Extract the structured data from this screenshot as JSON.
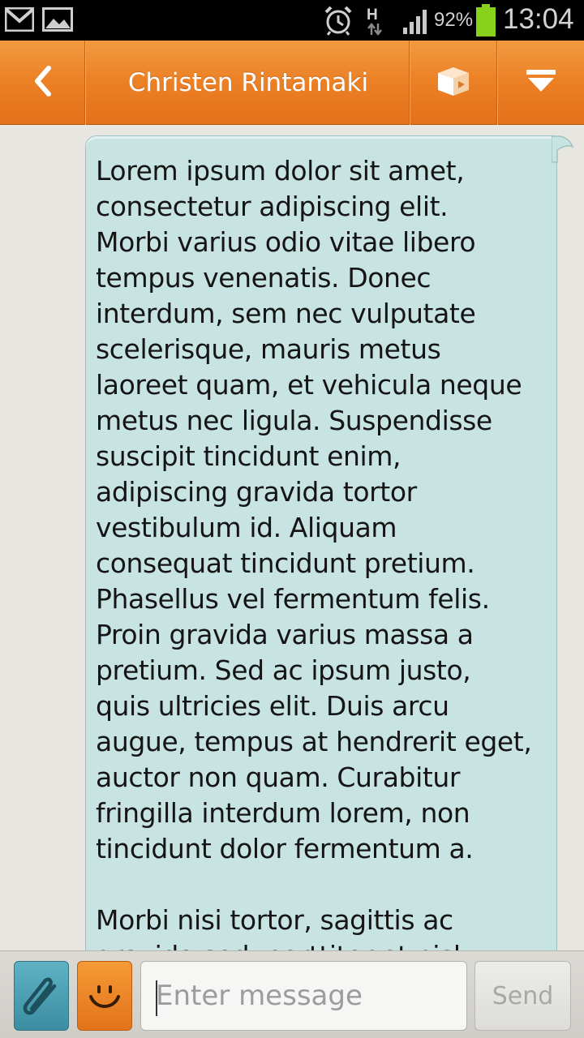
{
  "status_bar": {
    "network_type": "H",
    "battery_percent": "92%",
    "time": "13:04",
    "icons": [
      "gmail-icon",
      "gallery-icon",
      "alarm-clock-icon",
      "hspa-data-icon",
      "signal-strength-icon",
      "battery-icon"
    ]
  },
  "action_bar": {
    "contact_name": "Christen Rintamaki",
    "icons": [
      "back-arrow-icon",
      "box-icon",
      "overflow-menu-icon"
    ]
  },
  "conversation": {
    "messages": [
      {
        "direction": "outgoing",
        "text": "Lorem ipsum dolor sit amet,\nconsectetur adipiscing elit.\nMorbi varius odio vitae libero\ntempus venenatis. Donec\ninterdum, sem nec vulputate\nscelerisque, mauris metus\nlaoreet quam, et vehicula neque\nmetus nec ligula. Suspendisse\nsuscipit tincidunt enim,\nadipiscing gravida tortor\nvestibulum id. Aliquam\nconsequat tincidunt pretium.\nPhasellus vel fermentum felis.\nProin gravida varius massa a\npretium. Sed ac ipsum justo,\nquis ultricies elit. Duis arcu\naugue, tempus at hendrerit eget,\nauctor non quam. Curabitur\nfringilla interdum lorem, non\ntincidunt dolor fermentum a.\n\nMorbi nisi tortor, sagittis ac\ngravida sed, porttitor et nisl."
      }
    ]
  },
  "compose": {
    "placeholder": "Enter message",
    "value": "",
    "send_label": "Send",
    "icons": [
      "paperclip-icon",
      "smiley-icon"
    ]
  },
  "colors": {
    "action_bar": "#ec8025",
    "bubble": "#c7e3e2",
    "attach_button": "#4b9fb3",
    "emoticon_button": "#ee8529"
  }
}
